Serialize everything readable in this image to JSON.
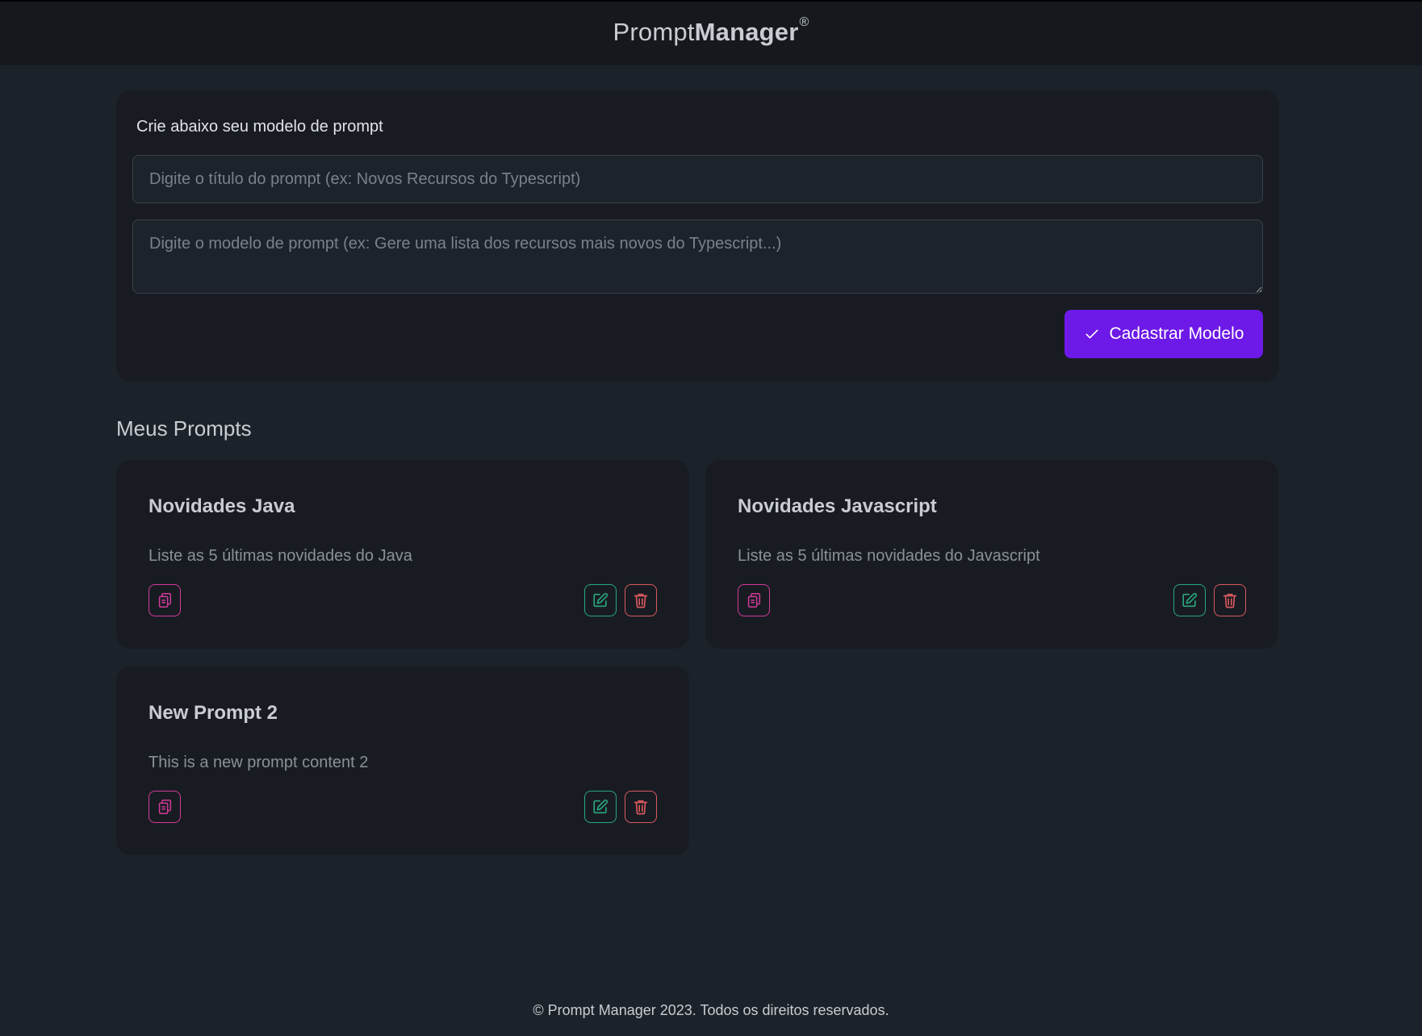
{
  "header": {
    "brand_light": "Prompt",
    "brand_bold": "Manager",
    "brand_mark": "®"
  },
  "form": {
    "heading": "Crie abaixo seu modelo de prompt",
    "title_placeholder": "Digite o título do prompt (ex: Novos Recursos do Typescript)",
    "content_placeholder": "Digite o modelo de prompt (ex: Gere uma lista dos recursos mais novos do Typescript...)",
    "submit_label": "Cadastrar Modelo"
  },
  "prompts": {
    "section_title": "Meus Prompts",
    "items": [
      {
        "title": "Novidades Java",
        "content": "Liste as 5 últimas novidades do Java"
      },
      {
        "title": "Novidades Javascript",
        "content": "Liste as 5 últimas novidades do Javascript"
      },
      {
        "title": "New Prompt 2",
        "content": "This is a new prompt content 2"
      }
    ]
  },
  "footer": {
    "text": "© Prompt Manager 2023. Todos os direitos reservados."
  },
  "colors": {
    "accent": "#6d19e8",
    "copy": "#d23a9a",
    "edit": "#2aa67e",
    "delete": "#d9595f"
  },
  "icons": {
    "copy": "clipboard-copy-icon",
    "edit": "pencil-square-icon",
    "delete": "trash-icon",
    "submit": "check-icon"
  }
}
